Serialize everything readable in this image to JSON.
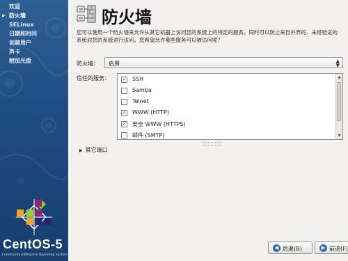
{
  "sidebar": {
    "items": [
      {
        "label": "欢迎",
        "active": false
      },
      {
        "label": "防火墙",
        "active": true
      },
      {
        "label": "SELinux",
        "active": false
      },
      {
        "label": "日期和时间",
        "active": false
      },
      {
        "label": "创建用户",
        "active": false
      },
      {
        "label": "声卡",
        "active": false
      },
      {
        "label": "附加光盘",
        "active": false
      }
    ],
    "brand": "CentOS-5",
    "brand_sub": "Community ENTerprise Operating System"
  },
  "page": {
    "title": "防火墙",
    "title_icon": "firewall-icon",
    "description": "您可以使用一个防火墙来允许从其它机器上访问您的系统上的特定的服务，同时可以防止来自外界的、未经验证的系统对您的系统进行访问。您希望允许哪些服务可以被访问呢？"
  },
  "firewall": {
    "label": "防火墙：",
    "value": "启用"
  },
  "trusted_services": {
    "label": "信任的服务：",
    "items": [
      {
        "label": "SSH",
        "checked": true
      },
      {
        "label": "Samba",
        "checked": false
      },
      {
        "label": "Telnet",
        "checked": false
      },
      {
        "label": "WWW (HTTP)",
        "checked": true
      },
      {
        "label": "安全 WWW (HTTPS)",
        "checked": true
      },
      {
        "label": "邮件 (SMTP)",
        "checked": false
      }
    ]
  },
  "other_ports": {
    "label": "其它端口"
  },
  "buttons": {
    "back_label": "后退(B)",
    "next_label": "前进(F)"
  },
  "colors": {
    "sidebar": "#1f4c80",
    "background": "#f2f1ef",
    "button_icon": "#3a6fb5"
  }
}
